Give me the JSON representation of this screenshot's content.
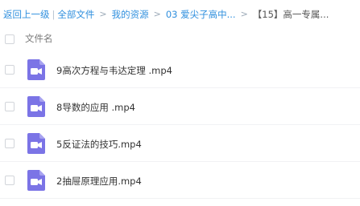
{
  "breadcrumb": {
    "back_label": "返回上一级",
    "all_files_label": "全部文件",
    "path": [
      "我的资源",
      "03 爱尖子高中...",
      "【15】高一专属..."
    ]
  },
  "file_list": {
    "header_label": "文件名",
    "items": [
      {
        "name": "9高次方程与韦达定理 .mp4",
        "icon": "video-file-icon"
      },
      {
        "name": "8导数的应用 .mp4",
        "icon": "video-file-icon"
      },
      {
        "name": "5反证法的技巧.mp4",
        "icon": "video-file-icon"
      },
      {
        "name": "2抽屉原理应用.mp4",
        "icon": "video-file-icon"
      }
    ]
  },
  "colors": {
    "link": "#2f8fde",
    "icon_purple": "#7b74e6",
    "text": "#333333",
    "muted": "#7a7a7a"
  }
}
